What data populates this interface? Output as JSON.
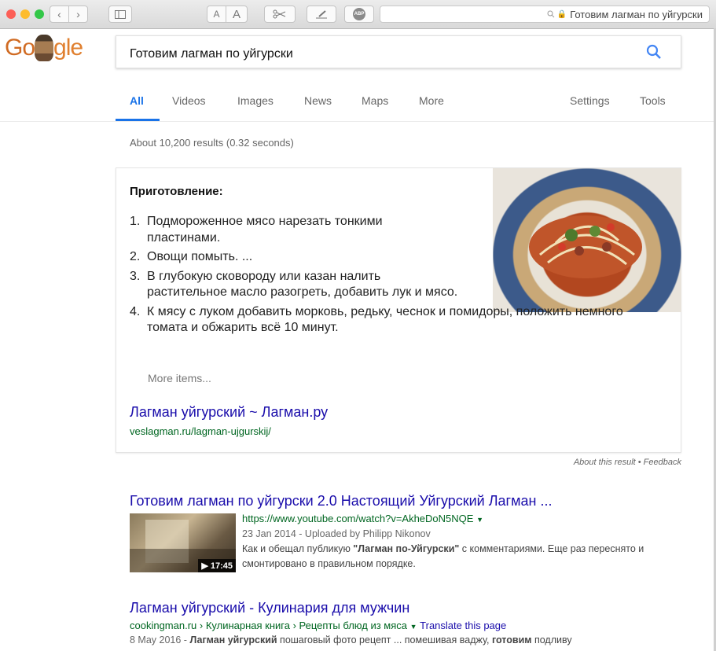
{
  "browser": {
    "address_text": "Готовим лагман по уйгурски",
    "text_small_label": "A",
    "text_large_label": "A",
    "abp_label": "ABP",
    "traffic_colors": [
      "#fc5f57",
      "#fdbc2e",
      "#33c748"
    ]
  },
  "google": {
    "logo_left": "Go",
    "logo_right": "gle",
    "query": "Готовим лагман по уйгурски",
    "accent": "#1a73e8",
    "tabs": [
      "All",
      "Videos",
      "Images",
      "News",
      "Maps",
      "More"
    ],
    "tools": [
      "Settings",
      "Tools"
    ],
    "stats": "About 10,200 results (0.32 seconds)"
  },
  "featured": {
    "title": "Приготовление:",
    "steps": [
      {
        "num": "1.",
        "text": "Подмороженное мясо нарезать тонкими пластинами."
      },
      {
        "num": "2.",
        "text": "Овощи помыть. ..."
      },
      {
        "num": "3.",
        "text": "В глубокую сковороду или казан налить растительное масло разогреть, добавить лук и мясо."
      },
      {
        "num": "4.",
        "text": "К мясу с луком добавить морковь, редьку, чеснок и помидоры, положить немного томата и обжарить всё 10 минут."
      }
    ],
    "more_items": "More items...",
    "link_title": "Лагман уйгурский ~ Лагман.ру",
    "link_url": "veslagman.ru/lagman-ujgurskij/",
    "about": "About this result • Feedback"
  },
  "results": [
    {
      "title": "Готовим лагман по уйгурски 2.0 Настоящий Уйгурский Лагман ...",
      "url": "https://www.youtube.com/watch?v=AkheDoN5NQE",
      "meta": "23 Jan 2014 - Uploaded by Philipp Nikonov",
      "snippet_pre": "Как и обещал публикую ",
      "snippet_bold": "\"Лагман по-Уйгурски\"",
      "snippet_post": " с комментариями. Еще раз переснято и смонтировано в правильном порядке.",
      "duration": "▶ 17:45"
    },
    {
      "title": "Лагман уйгурский - Кулинария для мужчин",
      "url": "cookingman.ru › Кулинарная книга › Рецепты блюд из мяса",
      "translate": "Translate this page",
      "date": "8 May 2016 - ",
      "snippet_bold1": "Лагман уйгурский",
      "snippet_mid": " пошаговый фото рецепт ... помешивая ваджу, ",
      "snippet_bold2": "готовим",
      "snippet_post": " подливу"
    }
  ]
}
